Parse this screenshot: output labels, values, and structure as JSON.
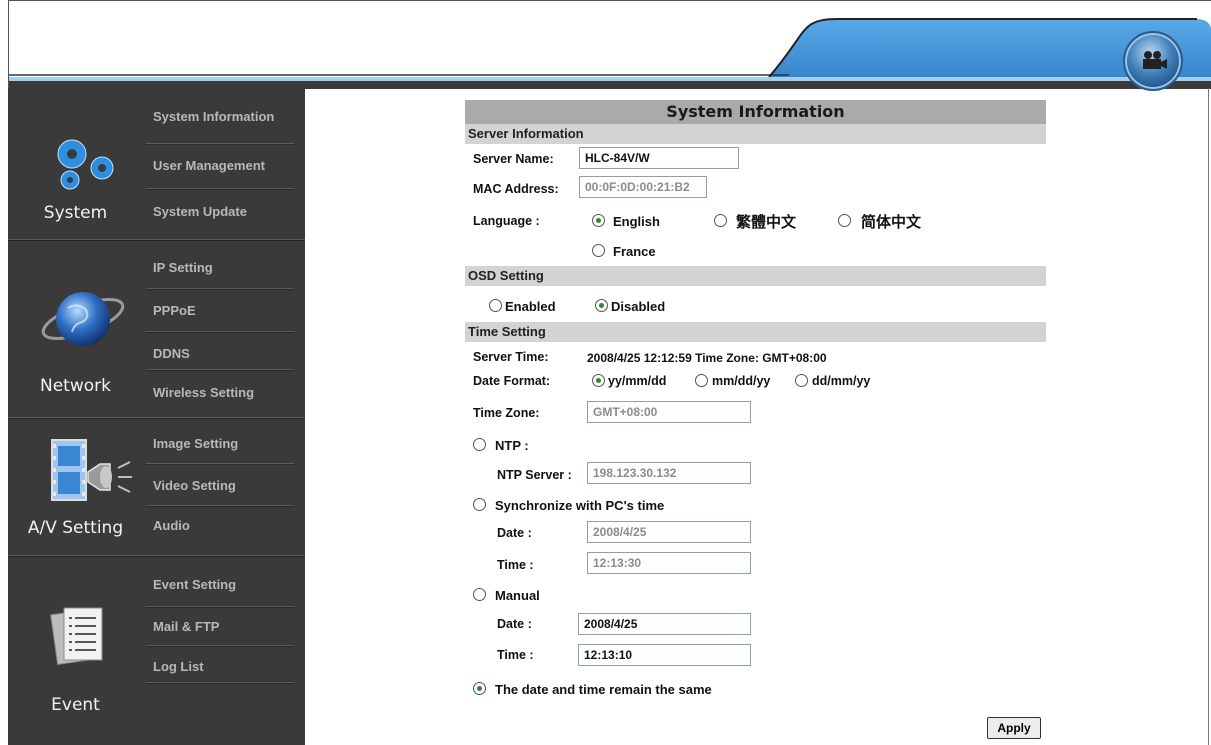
{
  "sidebar": {
    "sections": [
      {
        "title": "System",
        "items": [
          "System Information",
          "User Management",
          "System Update"
        ]
      },
      {
        "title": "Network",
        "items": [
          "IP Setting",
          "PPPoE",
          "DDNS",
          "Wireless Setting"
        ]
      },
      {
        "title": "A/V Setting",
        "items": [
          "Image Setting",
          "Video Setting",
          "Audio"
        ]
      },
      {
        "title": "Event",
        "items": [
          "Event Setting",
          "Mail & FTP",
          "Log List"
        ]
      }
    ]
  },
  "panel": {
    "title": "System Information",
    "server_info": {
      "header": "Server Information",
      "server_name_label": "Server Name:",
      "server_name_value": "HLC-84V/W",
      "mac_label": "MAC Address:",
      "mac_value": "00:0F:0D:00:21:B2",
      "language_label": "Language :",
      "languages": [
        "English",
        "繁體中文",
        "简体中文",
        "France"
      ],
      "language_selected": "English"
    },
    "osd": {
      "header": "OSD Setting",
      "options": [
        "Enabled",
        "Disabled"
      ],
      "selected": "Disabled"
    },
    "time": {
      "header": "Time Setting",
      "server_time_label": "Server Time:",
      "server_time_value": "2008/4/25 12:12:59 Time Zone: GMT+08:00",
      "date_format_label": "Date Format:",
      "date_formats": [
        "yy/mm/dd",
        "mm/dd/yy",
        "dd/mm/yy"
      ],
      "date_format_selected": "yy/mm/dd",
      "time_zone_label": "Time Zone:",
      "time_zone_value": "GMT+08:00",
      "ntp_label": "NTP :",
      "ntp_server_label": "NTP Server :",
      "ntp_server_value": "198.123.30.132",
      "sync_label": "Synchronize with PC's time",
      "sync_date_label": "Date :",
      "sync_date_value": "2008/4/25",
      "sync_time_label": "Time :",
      "sync_time_value": "12:13:30",
      "manual_label": "Manual",
      "manual_date_label": "Date :",
      "manual_date_value": "2008/4/25",
      "manual_time_label": "Time :",
      "manual_time_value": "12:13:10",
      "remain_label": "The date and time remain the same",
      "time_mode_selected": "remain"
    },
    "apply_label": "Apply"
  },
  "colors": {
    "header_blue": "#3b8ed6",
    "sidebar_bg": "#3a3a3a",
    "title_bar": "#aaaaaa",
    "section_bar": "#d3d3d3"
  }
}
